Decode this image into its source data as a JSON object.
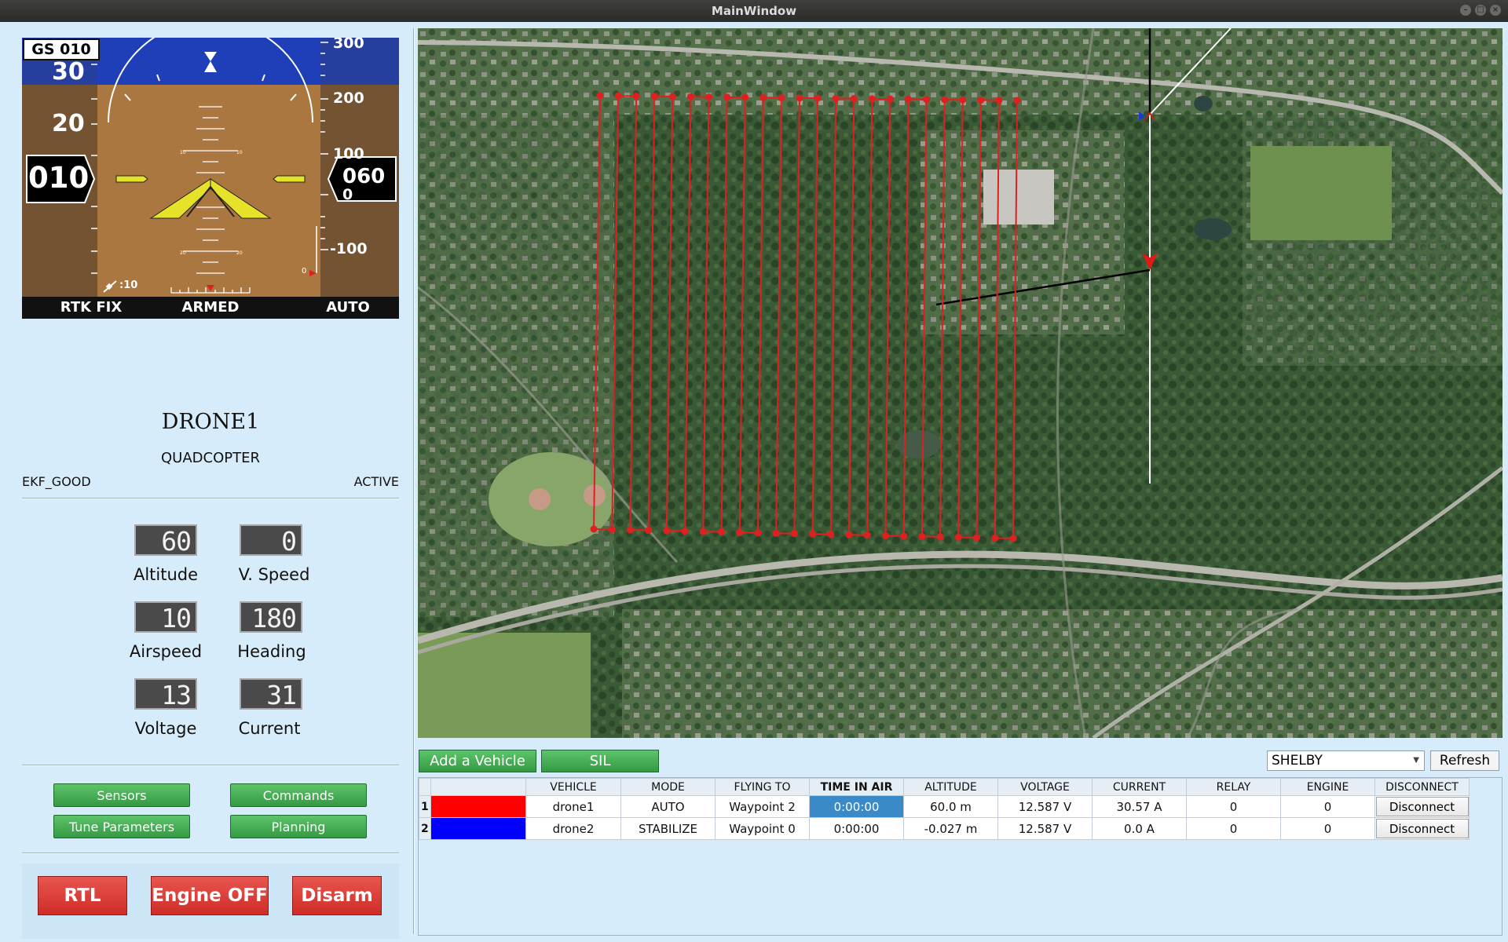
{
  "window": {
    "title": "MainWindow"
  },
  "pfd": {
    "groundspeed_box": "GS 010",
    "speed_tape": [
      "30",
      "20"
    ],
    "airspeed": "010",
    "altitude": "060",
    "alt_tape": [
      "300",
      "200",
      "100",
      "0",
      "-100"
    ],
    "vsi_zero": "0",
    "gps_sats": ":10",
    "status": {
      "fix": "RTK FIX",
      "armed": "ARMED",
      "mode": "AUTO"
    },
    "colors": {
      "sky": "#1f3fb8",
      "ground": "#a9773f",
      "tape": "#6b4c31",
      "wings": "#e6e22a"
    }
  },
  "vehicle": {
    "name": "DRONE1",
    "type": "QUADCOPTER",
    "ekf": "EKF_GOOD",
    "state": "ACTIVE"
  },
  "gauges": [
    {
      "value": "60",
      "label": "Altitude"
    },
    {
      "value": "0",
      "label": "V. Speed"
    },
    {
      "value": "10",
      "label": "Airspeed"
    },
    {
      "value": "180",
      "label": "Heading"
    },
    {
      "value": "13",
      "label": "Voltage"
    },
    {
      "value": "31",
      "label": "Current"
    }
  ],
  "tool_buttons": {
    "sensors": "Sensors",
    "commands": "Commands",
    "tune": "Tune  Parameters",
    "planning": "Planning"
  },
  "action_buttons": {
    "rtl": "RTL",
    "engine": "Engine  OFF",
    "disarm": "Disarm"
  },
  "bottom_bar": {
    "add_vehicle": "Add  a  Vehicle",
    "sil": "SIL",
    "selected_area": "SHELBY",
    "refresh": "Refresh"
  },
  "table": {
    "headers": [
      "VEHICLE",
      "MODE",
      "FLYING TO",
      "TIME IN AIR",
      "ALTITUDE",
      "VOLTAGE",
      "CURRENT",
      "RELAY",
      "ENGINE",
      "DISCONNECT"
    ],
    "rows": [
      {
        "num": "1",
        "color": "#ff0000",
        "vehicle": "drone1",
        "mode": "AUTO",
        "flying_to": "Waypoint 2",
        "time": "0:00:00",
        "altitude": "60.0 m",
        "voltage": "12.587 V",
        "current": "30.57 A",
        "relay": "0",
        "engine": "0",
        "disconnect": "Disconnect"
      },
      {
        "num": "2",
        "color": "#0000ff",
        "vehicle": "drone2",
        "mode": "STABILIZE",
        "flying_to": "Waypoint 0",
        "time": "0:00:00",
        "altitude": "-0.027 m",
        "voltage": "12.587 V",
        "current": "0.0 A",
        "relay": "0",
        "engine": "0",
        "disconnect": "Disconnect"
      }
    ]
  },
  "map": {
    "path_color": "#e02020",
    "survey_columns": 24
  }
}
